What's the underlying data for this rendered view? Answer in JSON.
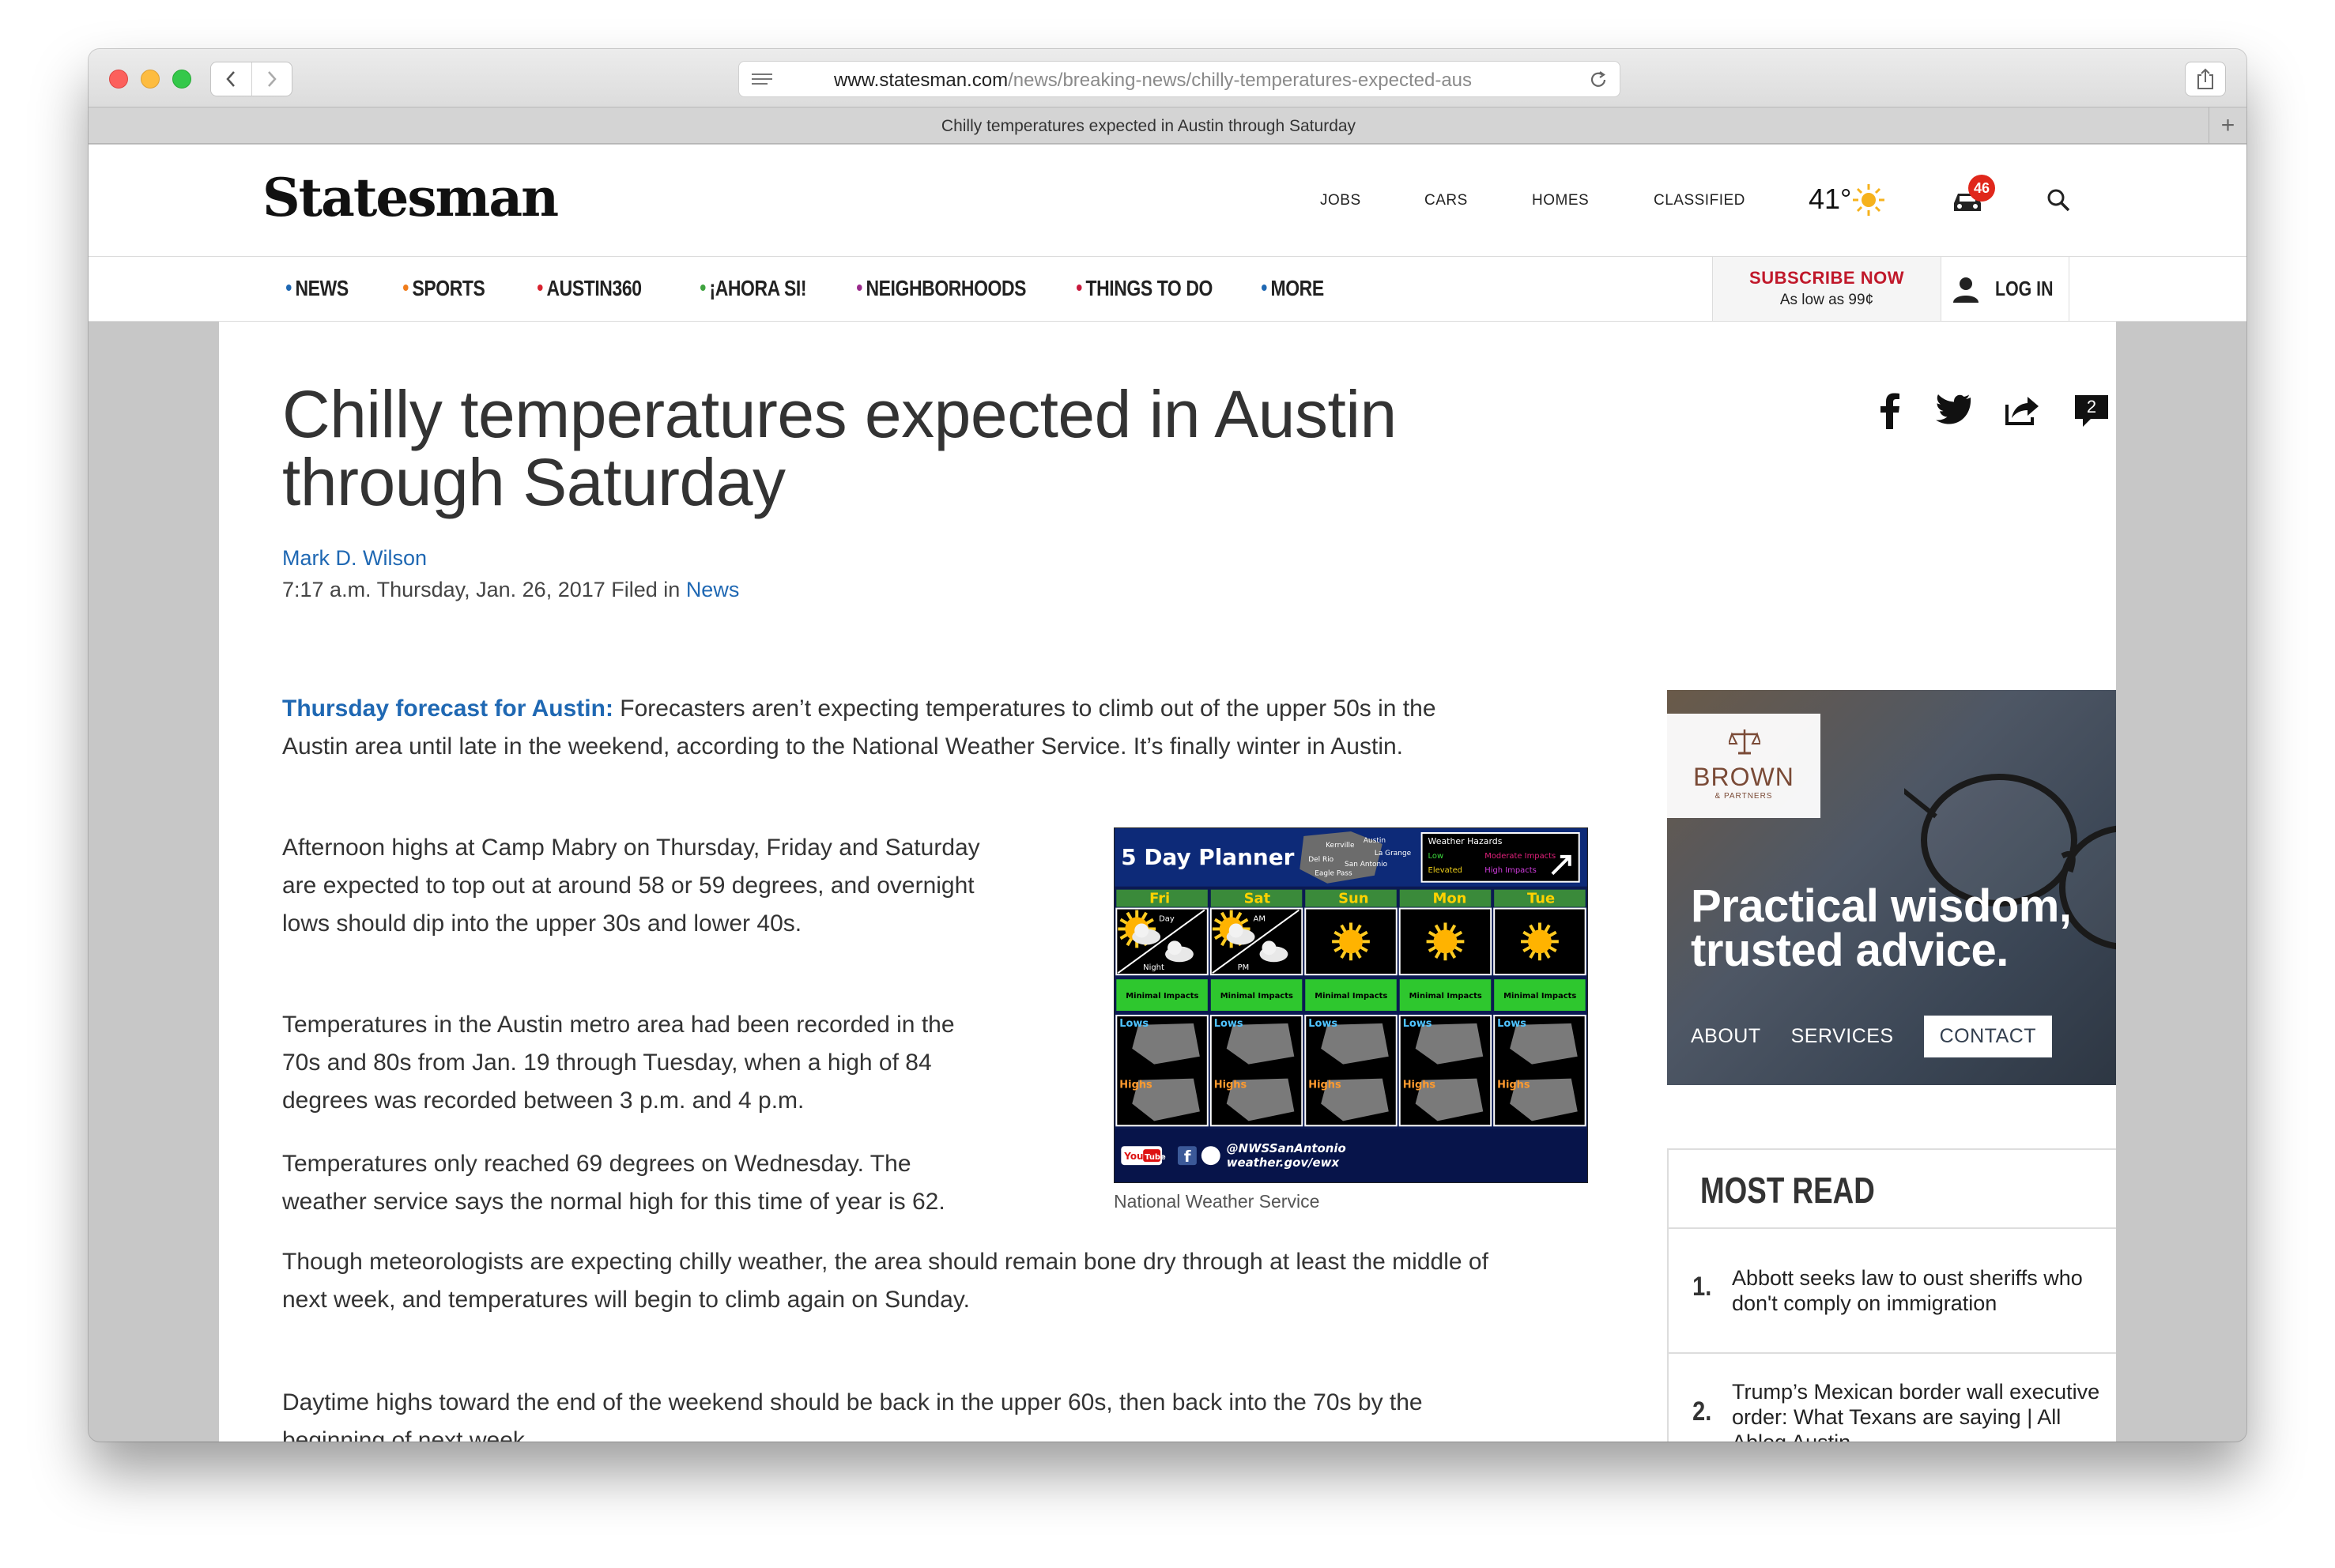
{
  "browser": {
    "url_domain": "www.statesman.com",
    "url_path": "/news/breaking-news/chilly-temperatures-expected-aus",
    "tab_title": "Chilly temperatures expected in Austin through Saturday"
  },
  "header": {
    "logo": "Statesman",
    "links": [
      "JOBS",
      "CARS",
      "HOMES",
      "CLASSIFIED"
    ],
    "temperature": "41°",
    "notification_count": "46"
  },
  "nav": {
    "items": [
      {
        "label": "NEWS",
        "color": "#1f68b3"
      },
      {
        "label": "SPORTS",
        "color": "#f07c1b"
      },
      {
        "label": "AUSTIN360",
        "color": "#d9232f"
      },
      {
        "label": "¡AHORA SI!",
        "color": "#3fa33f"
      },
      {
        "label": "NEIGHBORHOODS",
        "color": "#9a2a8c"
      },
      {
        "label": "THINGS TO DO",
        "color": "#c8193c"
      },
      {
        "label": "MORE",
        "color": "#1f68b3"
      }
    ],
    "subscribe_title": "SUBSCRIBE NOW",
    "subscribe_sub": "As low as 99¢",
    "login": "LOG IN"
  },
  "article": {
    "headline": "Chilly temperatures expected in Austin through Saturday",
    "author": "Mark D. Wilson",
    "dateline": "7:17 a.m. Thursday, Jan. 26, 2017 Filed in",
    "category": "News",
    "comment_count": "2",
    "lead_label": "Thursday forecast for Austin:",
    "paragraphs": [
      "Forecasters aren’t expecting temperatures to climb out of the upper 50s in the Austin area until late in the weekend, according to the National Weather Service. It’s finally winter in Austin.",
      "Afternoon highs at Camp Mabry on Thursday, Friday and Saturday are expected to top out at around 58 or 59 degrees, and overnight lows should dip into the upper 30s and lower 40s.",
      "Temperatures in the Austin metro area had been recorded in the 70s and 80s from Jan. 19 through Tuesday, when a high of 84 degrees was recorded between 3 p.m. and 4 p.m.",
      "Temperatures only reached 69 degrees on Wednesday. The weather service says the normal high for this time of year is 62.",
      "Though meteorologists are expecting chilly weather, the area should remain bone dry through at least the middle of next week, and temperatures will begin to climb again on Sunday.",
      "Daytime highs toward the end of the weekend should be back in the upper 60s, then back into the 70s by the beginning of next week."
    ],
    "image_caption": "National Weather Service"
  },
  "weather_graphic": {
    "title": "5 Day Planner",
    "places": [
      "Kerrville",
      "Austin",
      "La Grange",
      "Del Rio",
      "San Antonio",
      "Eagle Pass"
    ],
    "hazards_title": "Weather Hazards",
    "hazard_levels": [
      {
        "label": "Low",
        "color": "#3ddc3d"
      },
      {
        "label": "Moderate Impacts",
        "color": "#e0207a"
      },
      {
        "label": "Elevated",
        "color": "#f2d21a"
      },
      {
        "label": "High Impacts",
        "color": "#d23ce0"
      }
    ],
    "days": [
      "Fri",
      "Sat",
      "Sun",
      "Mon",
      "Tue"
    ],
    "day_labels": {
      "fri_top": "Day",
      "fri_bottom": "Night",
      "sat_top": "AM",
      "sat_bottom": "PM"
    },
    "impact_label": "Minimal Impacts",
    "lows_label": "Lows",
    "highs_label": "Highs",
    "footer_handle": "@NWSSanAntonio",
    "footer_site": "weather.gov/ewx"
  },
  "sidebar": {
    "ad": {
      "brand": "BROWN",
      "brand_sub": "& PARTNERS",
      "headline_line1": "Practical wisdom,",
      "headline_line2": "trusted advice.",
      "links": [
        "ABOUT",
        "SERVICES"
      ],
      "contact": "CONTACT"
    },
    "most_read": {
      "title": "MOST READ",
      "items": [
        {
          "num": "1.",
          "text": "Abbott seeks law to oust sheriffs who don't comply on immigration"
        },
        {
          "num": "2.",
          "text": "Trump’s Mexican border wall executive order: What Texans are saying | All Ablog Austin"
        }
      ]
    }
  }
}
